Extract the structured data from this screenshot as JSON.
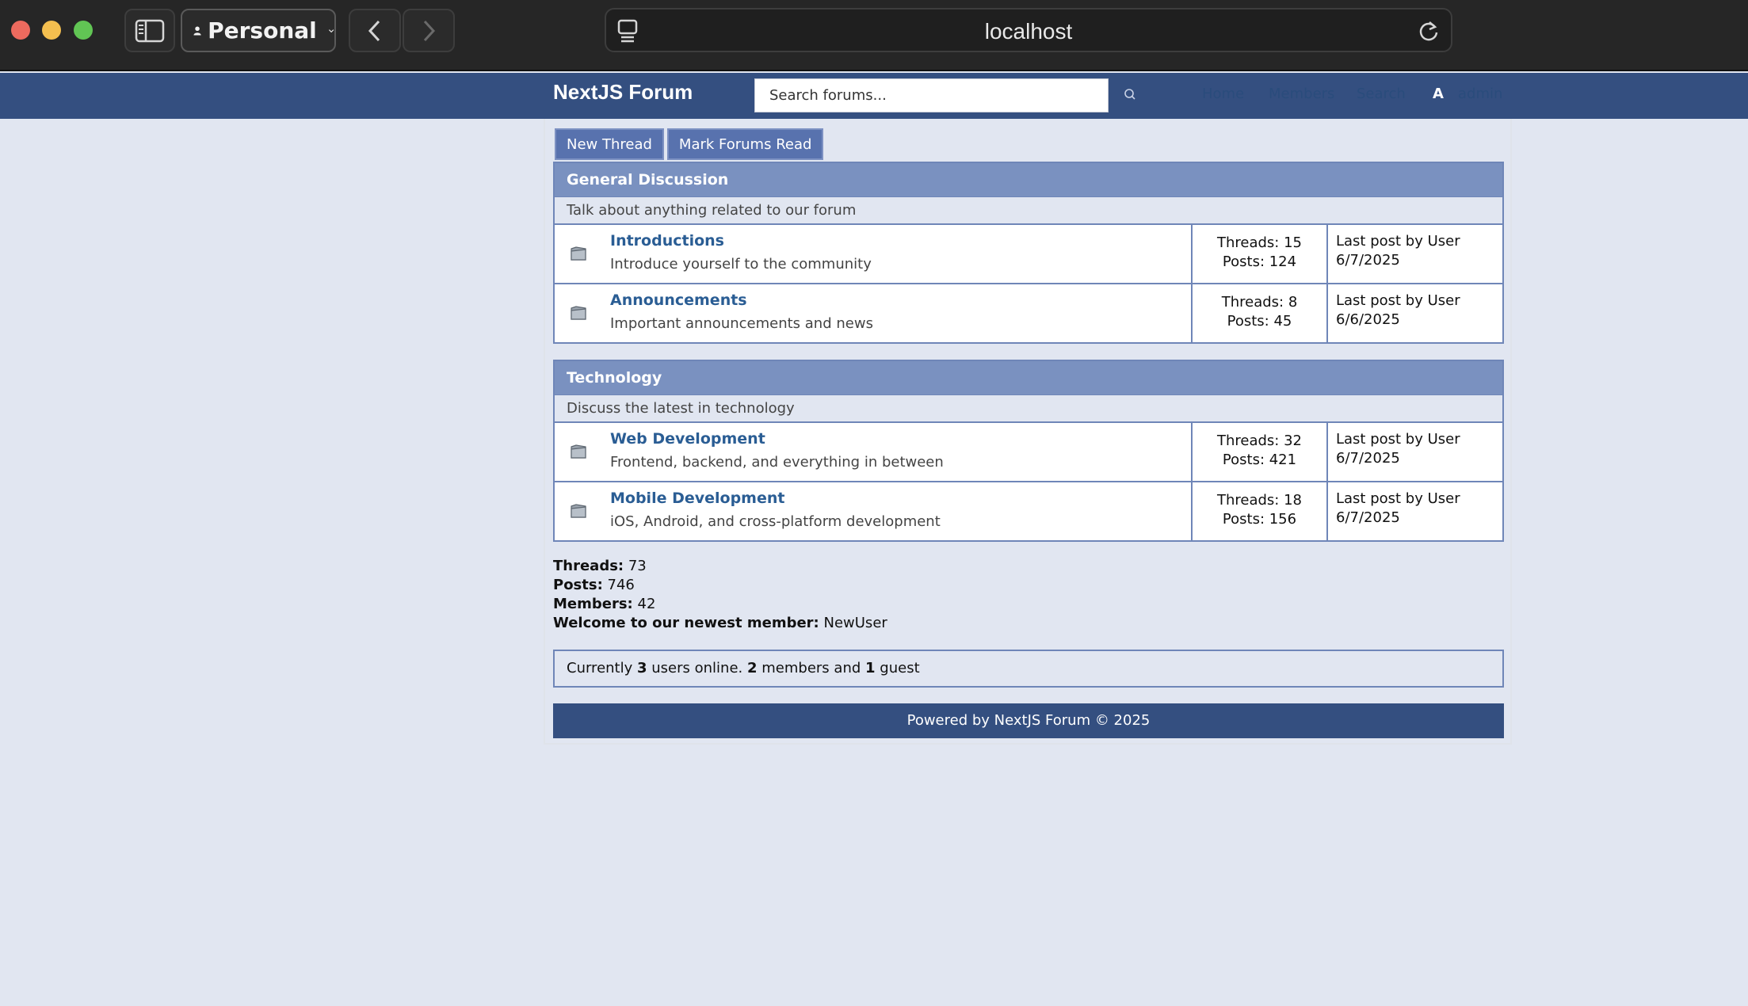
{
  "browser": {
    "profile_label": "Personal",
    "address": "localhost"
  },
  "header": {
    "brand": "NextJS Forum",
    "search_placeholder": "Search forums...",
    "nav": {
      "home": "Home",
      "members": "Members",
      "search": "Search"
    },
    "user_initial": "A",
    "username": "admin"
  },
  "actions": {
    "new_thread": "New Thread",
    "mark_read": "Mark Forums Read"
  },
  "categories": [
    {
      "title": "General Discussion",
      "description": "Talk about anything related to our forum",
      "forums": [
        {
          "name": "Introductions",
          "description": "Introduce yourself to the community",
          "threads": "Threads: 15",
          "posts": "Posts: 124",
          "last_post": "Last post by User",
          "last_date": "6/7/2025"
        },
        {
          "name": "Announcements",
          "description": "Important announcements and news",
          "threads": "Threads: 8",
          "posts": "Posts: 45",
          "last_post": "Last post by User",
          "last_date": "6/6/2025"
        }
      ]
    },
    {
      "title": "Technology",
      "description": "Discuss the latest in technology",
      "forums": [
        {
          "name": "Web Development",
          "description": "Frontend, backend, and everything in between",
          "threads": "Threads: 32",
          "posts": "Posts: 421",
          "last_post": "Last post by User",
          "last_date": "6/7/2025"
        },
        {
          "name": "Mobile Development",
          "description": "iOS, Android, and cross-platform development",
          "threads": "Threads: 18",
          "posts": "Posts: 156",
          "last_post": "Last post by User",
          "last_date": "6/7/2025"
        }
      ]
    }
  ],
  "stats": {
    "threads_label": "Threads:",
    "threads_value": "73",
    "posts_label": "Posts:",
    "posts_value": "746",
    "members_label": "Members:",
    "members_value": "42",
    "newest_label": "Welcome to our newest member:",
    "newest_value": "NewUser"
  },
  "online": {
    "prefix": "Currently",
    "total": "3",
    "mid1": "users online.",
    "members": "2",
    "mid2": "members and",
    "guests": "1",
    "suffix": "guest"
  },
  "footer": "Powered by NextJS Forum © 2025"
}
